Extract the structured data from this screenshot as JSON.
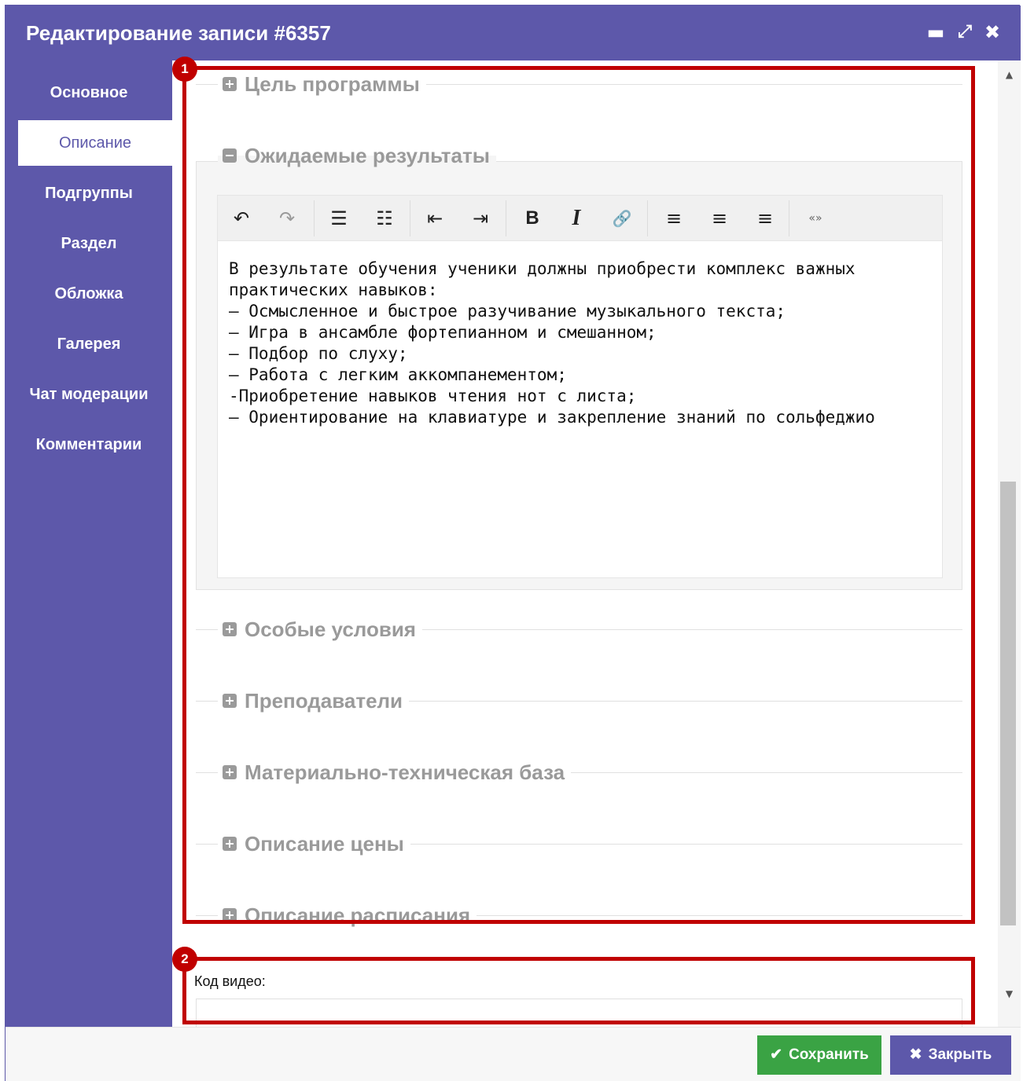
{
  "window": {
    "title": "Редактирование записи #6357",
    "minimize_glyph": "▬",
    "maximize_glyph": "⤢",
    "close_glyph": "✖"
  },
  "sidebar": {
    "items": [
      {
        "label": "Основное",
        "active": false
      },
      {
        "label": "Описание",
        "active": true
      },
      {
        "label": "Подгруппы",
        "active": false
      },
      {
        "label": "Раздел",
        "active": false
      },
      {
        "label": "Обложка",
        "active": false
      },
      {
        "label": "Галерея",
        "active": false
      },
      {
        "label": "Чат модерации",
        "active": false
      },
      {
        "label": "Комментарии",
        "active": false
      }
    ]
  },
  "sections": [
    {
      "title": "Цель программы",
      "state": "collapsed"
    },
    {
      "title": "Ожидаемые результаты",
      "state": "expanded"
    },
    {
      "title": "Особые условия",
      "state": "collapsed"
    },
    {
      "title": "Преподаватели",
      "state": "collapsed"
    },
    {
      "title": "Материально-техническая база",
      "state": "collapsed"
    },
    {
      "title": "Описание цены",
      "state": "collapsed"
    },
    {
      "title": "Описание расписания",
      "state": "collapsed"
    }
  ],
  "editor": {
    "toolbar": [
      {
        "name": "undo-icon",
        "glyph": "↶",
        "disabled": false
      },
      {
        "name": "redo-icon",
        "glyph": "↷",
        "disabled": true
      },
      {
        "name": "bullet-list-icon",
        "glyph": "☰",
        "disabled": false
      },
      {
        "name": "numbered-list-icon",
        "glyph": "☷",
        "disabled": false
      },
      {
        "name": "outdent-icon",
        "glyph": "⇤",
        "disabled": false
      },
      {
        "name": "indent-icon",
        "glyph": "⇥",
        "disabled": false
      },
      {
        "name": "bold-icon",
        "glyph": "B",
        "disabled": false
      },
      {
        "name": "italic-icon",
        "glyph": "I",
        "disabled": false
      },
      {
        "name": "link-icon",
        "glyph": "🔗",
        "disabled": false
      },
      {
        "name": "align-left-icon",
        "glyph": "≡",
        "disabled": false
      },
      {
        "name": "align-center-icon",
        "glyph": "≡",
        "disabled": false
      },
      {
        "name": "align-right-icon",
        "glyph": "≡",
        "disabled": false
      },
      {
        "name": "blockquote-icon",
        "glyph": "«»",
        "disabled": false
      }
    ],
    "lines": [
      "В результате обучения ученики должны приобрести комплекс важных",
      "практических навыков:",
      "– Осмысленное и быстрое разучивание музыкального текста;",
      "– Игра в ансамбле фортепианном и смешанном;",
      "– Подбор по слуху;",
      "– Работа с легким аккомпанементом;",
      "-Приобретение навыков чтения нот с листа;",
      "– Ориентирование на клавиатуре и закрепление знаний по сольфеджио"
    ]
  },
  "video": {
    "label": "Код видео:",
    "value": ""
  },
  "footer": {
    "save_label": "Сохранить",
    "save_icon": "✔",
    "close_label": "Закрыть",
    "close_icon": "✖"
  },
  "annotations": {
    "marker1": "1",
    "marker2": "2",
    "color": "#c00000"
  },
  "colors": {
    "accent": "#5d58aa",
    "save_green": "#3aa344",
    "legend_gray": "#9a9a9a"
  }
}
